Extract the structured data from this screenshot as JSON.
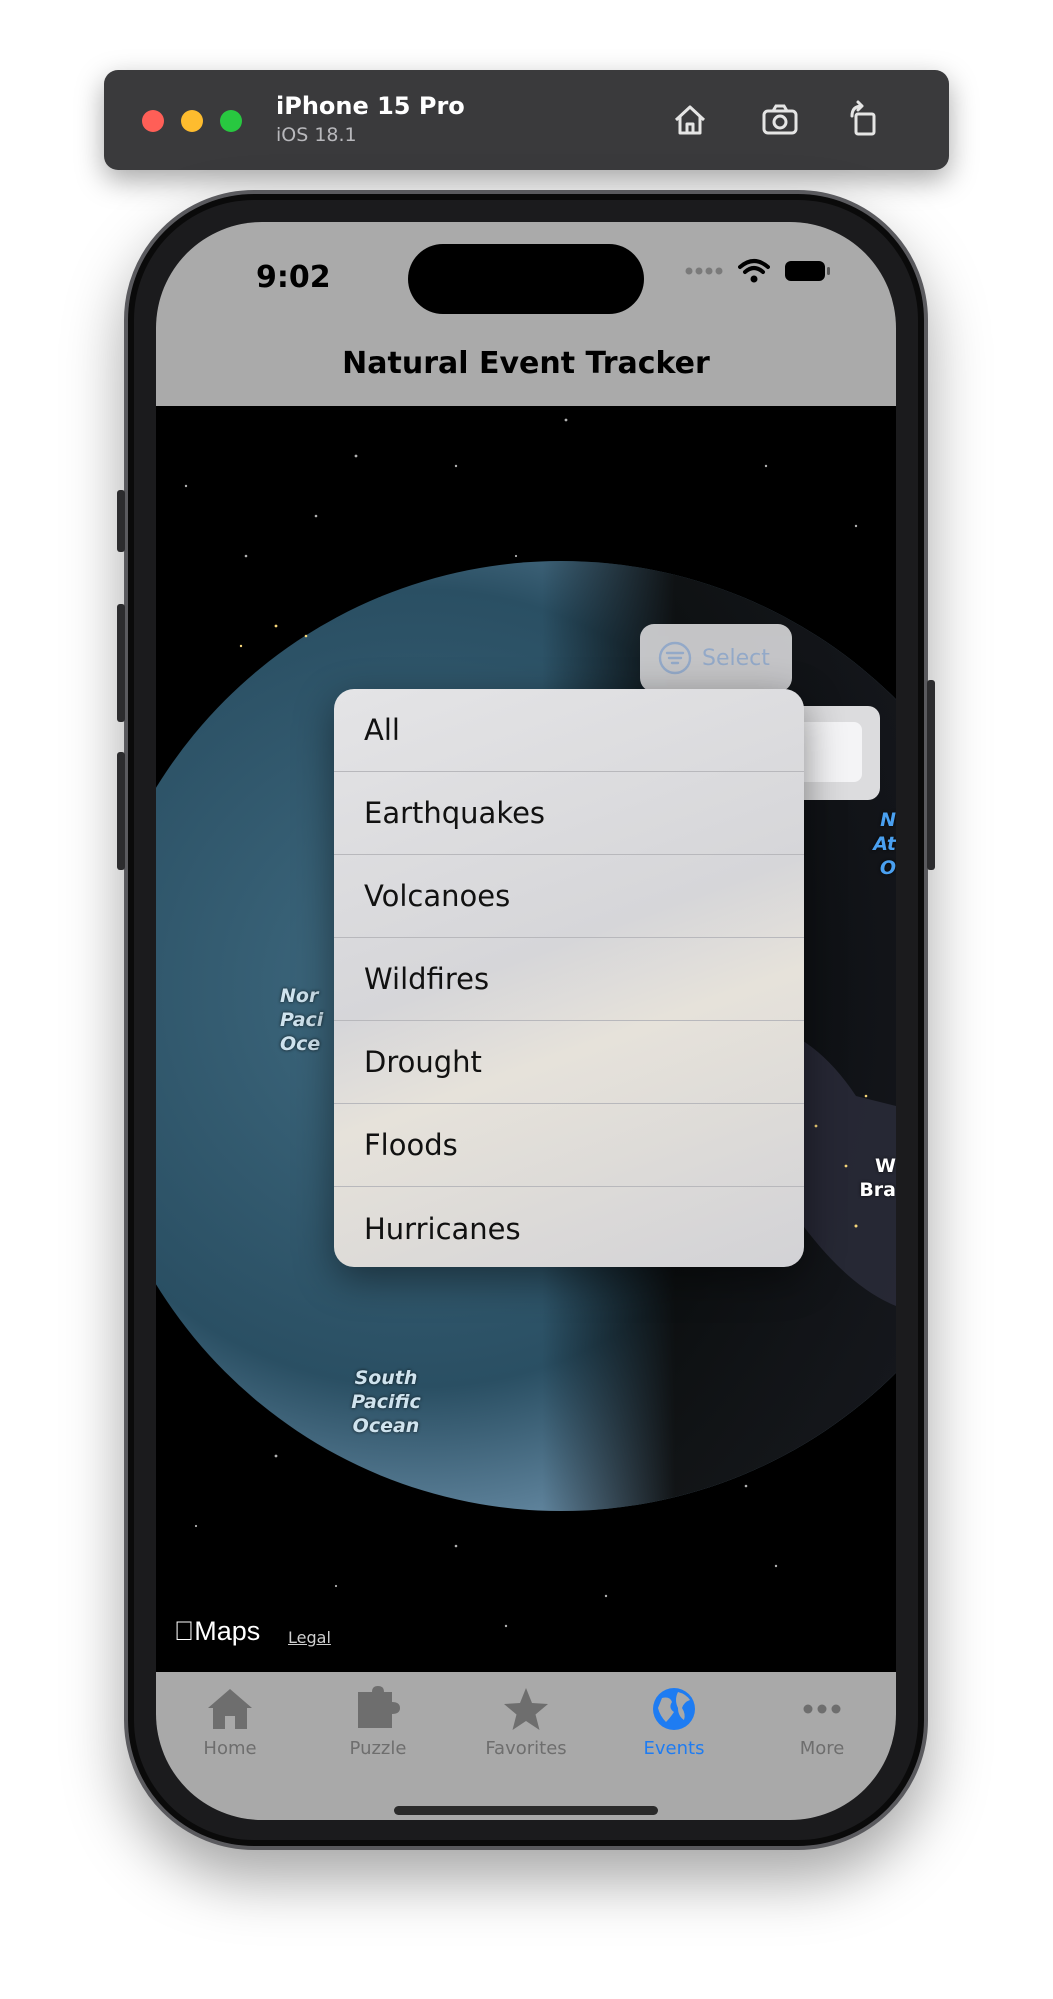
{
  "simulator": {
    "device_name": "iPhone 15 Pro",
    "os_version": "iOS 18.1",
    "home_icon": "house-icon",
    "screenshot_icon": "camera-icon",
    "rotate_icon": "rotate-icon"
  },
  "status_bar": {
    "time": "9:02"
  },
  "nav": {
    "title": "Natural Event Tracker"
  },
  "select_button": {
    "label": "Select",
    "icon": "filter-icon"
  },
  "menu": {
    "items": [
      "All",
      "Earthquakes",
      "Volcanoes",
      "Wildfires",
      "Drought",
      "Floods",
      "Hurricanes"
    ]
  },
  "map": {
    "labels": {
      "north_pacific": "Nor\nPaci\nOce",
      "south_pacific": "South\nPacific\nOcean",
      "north_atlantic": "N\nAt\nO",
      "brazil": "W\nBra"
    },
    "maps_brand": "Maps",
    "legal": "Legal"
  },
  "tabs": [
    {
      "label": "Home",
      "icon": "house-icon",
      "active": false
    },
    {
      "label": "Puzzle",
      "icon": "puzzle-icon",
      "active": false
    },
    {
      "label": "Favorites",
      "icon": "star-icon",
      "active": false
    },
    {
      "label": "Events",
      "icon": "globe-icon",
      "active": true
    },
    {
      "label": "More",
      "icon": "more-icon",
      "active": false
    }
  ],
  "colors": {
    "accent": "#1e7cf2",
    "bar_gray": "#aaaaaa",
    "inactive_tab": "#6e6e6e"
  }
}
